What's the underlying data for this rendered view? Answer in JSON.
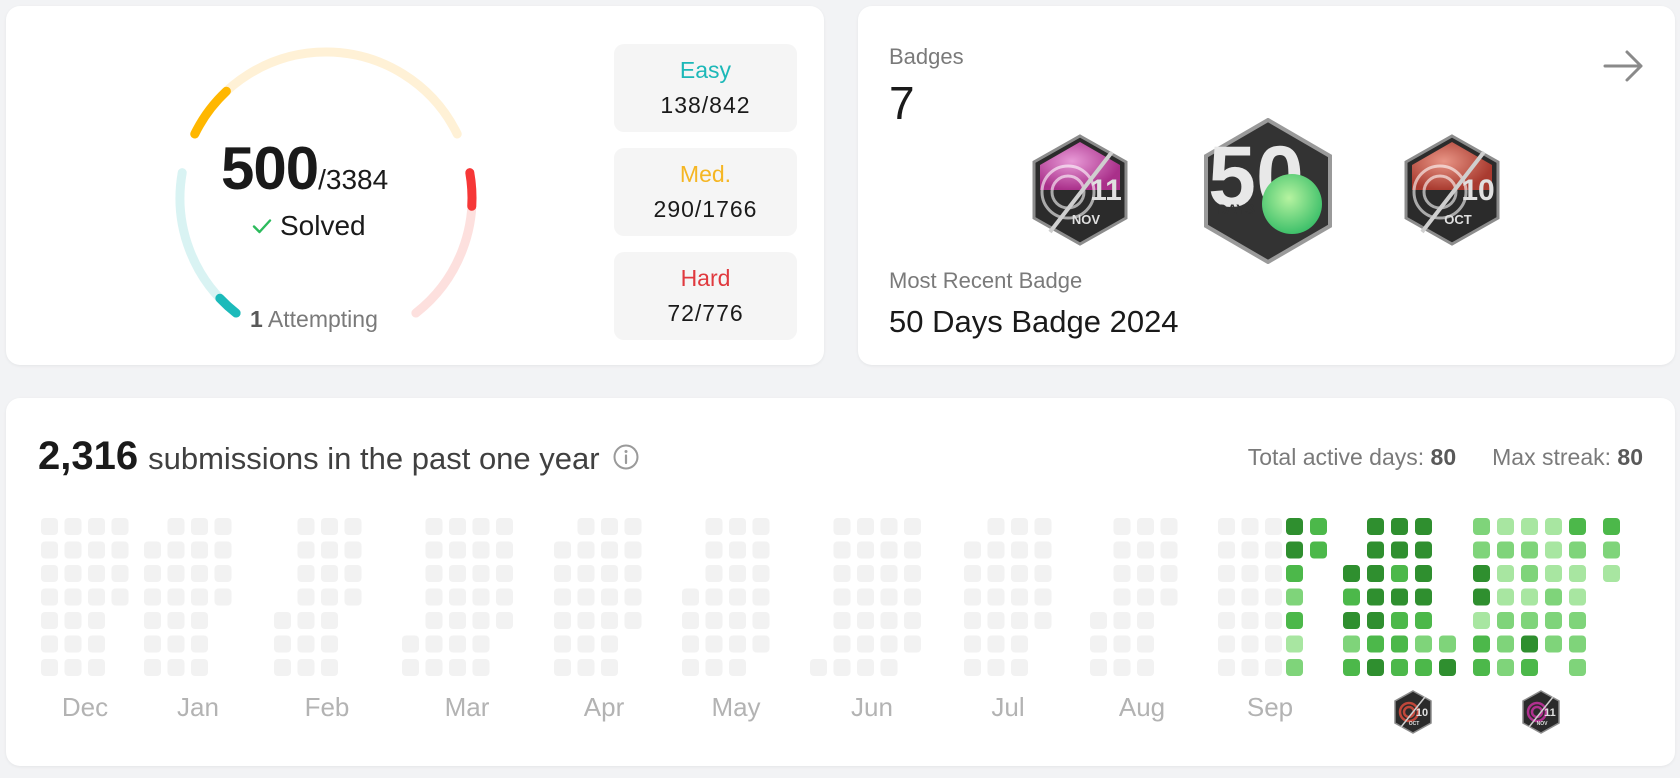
{
  "progress": {
    "solved": "500",
    "total": "/3384",
    "solved_label": "Solved",
    "attempting_count": "1",
    "attempting_label": "Attempting",
    "difficulties": [
      {
        "label": "Easy",
        "value": "138/842",
        "color": "#1cbaba",
        "fraction": 0.164
      },
      {
        "label": "Med.",
        "value": "290/1766",
        "color": "#ffb700",
        "fraction": 0.164
      },
      {
        "label": "Hard",
        "value": "72/776",
        "color": "#f63737",
        "fraction": 0.093
      }
    ]
  },
  "badges": {
    "label": "Badges",
    "count": "7",
    "items": [
      {
        "name": "nov-11-badge",
        "number": "11",
        "month": "NOV"
      },
      {
        "name": "50-days-badge",
        "number": "50",
        "text": "DAYS"
      },
      {
        "name": "oct-10-badge",
        "number": "10",
        "month": "OCT"
      }
    ],
    "recent_label": "Most Recent Badge",
    "recent_name": "50 Days Badge 2024"
  },
  "calendar": {
    "count": "2,316",
    "text": "submissions in the past one year",
    "active_days_label": "Total active days:",
    "active_days": "80",
    "max_streak_label": "Max streak:",
    "max_streak": "80",
    "months": [
      "Dec",
      "Jan",
      "Feb",
      "Mar",
      "Apr",
      "May",
      "Jun",
      "Jul",
      "Aug",
      "Sep"
    ],
    "month_badges": [
      {
        "number": "10",
        "month": "OCT"
      },
      {
        "number": "11",
        "month": "NOV"
      }
    ],
    "colors": {
      "empty": "#f2f2f2",
      "l1": "#a8e6a1",
      "l2": "#7fd47a",
      "l3": "#4cb84a",
      "l4": "#2f8f2f"
    },
    "active_weeks": [
      [
        4,
        4,
        3,
        2,
        3,
        1,
        2
      ],
      [
        3,
        3,
        0,
        0,
        0,
        0,
        0
      ],
      [
        0,
        0,
        4,
        3,
        4,
        2,
        3
      ],
      [
        4,
        4,
        4,
        4,
        4,
        3,
        4
      ],
      [
        4,
        4,
        3,
        4,
        3,
        3,
        3
      ],
      [
        4,
        4,
        4,
        4,
        3,
        2,
        3
      ],
      [
        0,
        0,
        0,
        0,
        0,
        2,
        4
      ],
      [
        2,
        2,
        4,
        4,
        1,
        3,
        3
      ],
      [
        1,
        2,
        1,
        1,
        2,
        2,
        2
      ],
      [
        1,
        2,
        2,
        1,
        2,
        4,
        3
      ],
      [
        1,
        1,
        1,
        2,
        2,
        2,
        0
      ],
      [
        3,
        2,
        1,
        1,
        2,
        2,
        2
      ],
      [
        3,
        2,
        1,
        0,
        0,
        0,
        0
      ]
    ]
  }
}
